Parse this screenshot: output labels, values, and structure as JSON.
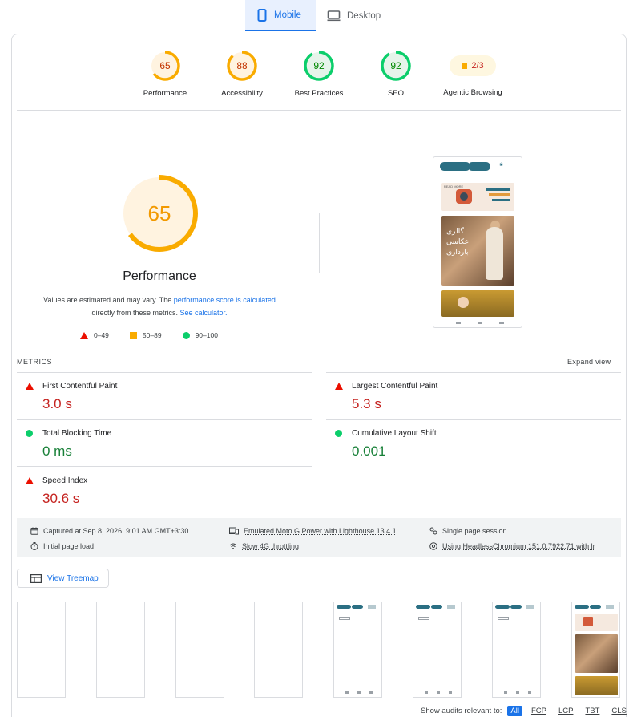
{
  "tabs": [
    {
      "label": "Mobile",
      "active": true
    },
    {
      "label": "Desktop",
      "active": false
    }
  ],
  "categories": [
    {
      "label": "Performance",
      "score": "65",
      "score_value": 65,
      "color": "#f9ab00",
      "text_color": "#c33300",
      "fill": "#fff3e0"
    },
    {
      "label": "Accessibility",
      "score": "88",
      "score_value": 88,
      "color": "#f9ab00",
      "text_color": "#c33300",
      "fill": "#fff3e0"
    },
    {
      "label": "Best Practices",
      "score": "92",
      "score_value": 92,
      "color": "#0cce6b",
      "text_color": "#008800",
      "fill": "#e6f4ea"
    },
    {
      "label": "SEO",
      "score": "92",
      "score_value": 92,
      "color": "#0cce6b",
      "text_color": "#008800",
      "fill": "#e6f4ea"
    }
  ],
  "agentic": {
    "label": "Agentic Browsing",
    "value": "2/3"
  },
  "performance": {
    "score": "65",
    "score_value": 65,
    "title": "Performance",
    "desc_1": "Values are estimated and may vary. The ",
    "desc_link_1": "performance score is calculated",
    "desc_2": "directly from these metrics. ",
    "desc_link_2": "See calculator."
  },
  "legend": [
    {
      "range": "0–49",
      "shape": "triangle",
      "color": "#eb0f00"
    },
    {
      "range": "50–89",
      "shape": "square",
      "color": "#f9ab00"
    },
    {
      "range": "90–100",
      "shape": "circle",
      "color": "#0cce6b"
    }
  ],
  "preview": {
    "banner_label": "READ MORE",
    "photo_text_1": "گالری",
    "photo_text_2": "عکاسی",
    "photo_text_3": "بارداری"
  },
  "metrics_header": "METRICS",
  "expand_label": "Expand view",
  "metrics": [
    {
      "name": "First Contentful Paint",
      "value": "3.0 s",
      "status": "fail"
    },
    {
      "name": "Largest Contentful Paint",
      "value": "5.3 s",
      "status": "fail"
    },
    {
      "name": "Total Blocking Time",
      "value": "0 ms",
      "status": "pass"
    },
    {
      "name": "Cumulative Layout Shift",
      "value": "0.001",
      "status": "pass"
    },
    {
      "name": "Speed Index",
      "value": "30.6 s",
      "status": "fail"
    }
  ],
  "info": {
    "captured": "Captured at Sep 8, 2026, 9:01 AM GMT+3:30",
    "initial_load": "Initial page load",
    "emulated": "Emulated Moto G Power with Lighthouse 13.4.1",
    "throttling": "Slow 4G throttling",
    "session": "Single page session",
    "browser": "Using HeadlessChromium 151.0.7922.71 with lr"
  },
  "treemap_label": "View Treemap",
  "audits": {
    "label": "Show audits relevant to:",
    "filters": [
      "All",
      "FCP",
      "LCP",
      "TBT",
      "CLS"
    ],
    "selected": "All"
  }
}
